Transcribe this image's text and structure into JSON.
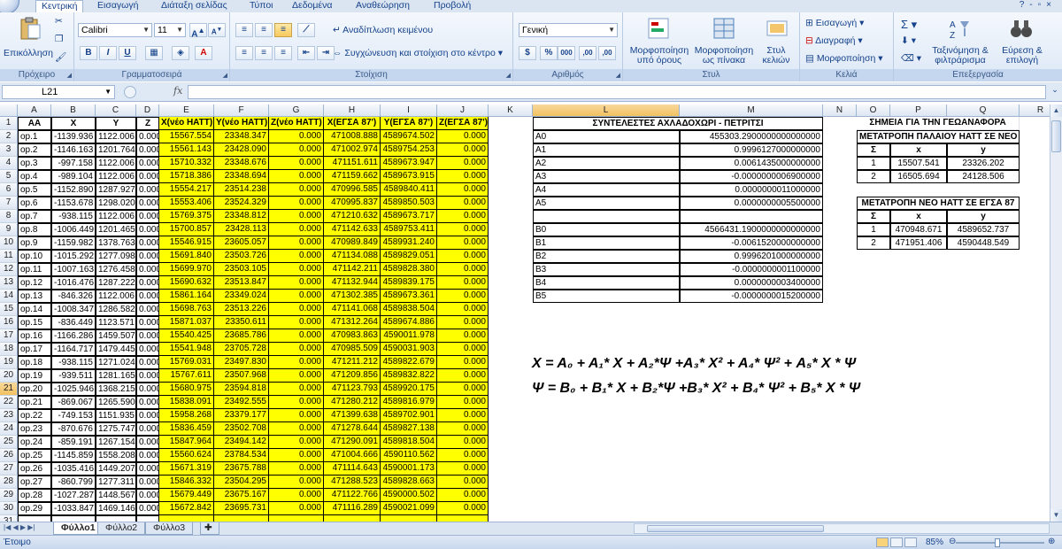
{
  "ribbon": {
    "tabs": [
      "Κεντρική",
      "Εισαγωγή",
      "Διάταξη σελίδας",
      "Τύποι",
      "Δεδομένα",
      "Αναθεώρηση",
      "Προβολή"
    ],
    "clipboard": {
      "label": "Πρόχειρο",
      "paste": "Επικόλληση"
    },
    "font": {
      "label": "Γραμματοσειρά",
      "name": "Calibri",
      "size": "11",
      "grow": "A",
      "shrink": "A",
      "bold": "B",
      "italic": "I",
      "underline": "U",
      "color": "A"
    },
    "alignment": {
      "label": "Στοίχιση",
      "wrap": "Αναδίπλωση κειμένου",
      "merge": "Συγχώνευση και στοίχιση στο κέντρο"
    },
    "number": {
      "label": "Αριθμός",
      "format": "Γενική",
      "percent": "%",
      "thousands": "000",
      "inc_dec": ",00",
      "dec_dec": ",00"
    },
    "styles": {
      "label": "Στυλ",
      "conditional": "Μορφοποίηση υπό όρους",
      "as_table": "Μορφοποίηση ως πίνακα",
      "cell_styles": "Στυλ κελιών"
    },
    "cells": {
      "label": "Κελιά",
      "insert": "Εισαγωγή",
      "delete": "Διαγραφή",
      "format": "Μορφοποίηση"
    },
    "editing": {
      "label": "Επεξεργασία",
      "sum": "Σ",
      "sort": "Ταξινόμηση & φιλτράρισμα",
      "find": "Εύρεση & επιλογή"
    }
  },
  "formula_bar": {
    "name_box": "L21",
    "fx": "fx",
    "content": ""
  },
  "columns": [
    "A",
    "B",
    "C",
    "D",
    "E",
    "F",
    "G",
    "H",
    "I",
    "J",
    "K",
    "L",
    "M",
    "N",
    "O",
    "P",
    "Q",
    "R",
    "S"
  ],
  "selected": {
    "row": "21",
    "col": "L"
  },
  "headers": [
    "AA",
    "X",
    "Y",
    "Z",
    "X(νέο HATT)",
    "Y(νέο HATT)",
    "Z(νέο HATT)",
    "X(ΕΓΣΑ 87')",
    "Y(ΕΓΣΑ 87')",
    "Z(ΕΓΣΑ 87')"
  ],
  "rows": [
    [
      "op.1",
      "-1139.936",
      "1122.006",
      "0.000",
      "15567.554",
      "23348.347",
      "0.000",
      "471008.888",
      "4589674.502",
      "0.000"
    ],
    [
      "op.2",
      "-1146.163",
      "1201.764",
      "0.000",
      "15561.143",
      "23428.090",
      "0.000",
      "471002.974",
      "4589754.253",
      "0.000"
    ],
    [
      "op.3",
      "-997.158",
      "1122.006",
      "0.000",
      "15710.332",
      "23348.676",
      "0.000",
      "471151.611",
      "4589673.947",
      "0.000"
    ],
    [
      "op.4",
      "-989.104",
      "1122.006",
      "0.000",
      "15718.386",
      "23348.694",
      "0.000",
      "471159.662",
      "4589673.915",
      "0.000"
    ],
    [
      "op.5",
      "-1152.890",
      "1287.927",
      "0.000",
      "15554.217",
      "23514.238",
      "0.000",
      "470996.585",
      "4589840.411",
      "0.000"
    ],
    [
      "op.6",
      "-1153.678",
      "1298.020",
      "0.000",
      "15553.406",
      "23524.329",
      "0.000",
      "470995.837",
      "4589850.503",
      "0.000"
    ],
    [
      "op.7",
      "-938.115",
      "1122.006",
      "0.000",
      "15769.375",
      "23348.812",
      "0.000",
      "471210.632",
      "4589673.717",
      "0.000"
    ],
    [
      "op.8",
      "-1006.449",
      "1201.465",
      "0.000",
      "15700.857",
      "23428.113",
      "0.000",
      "471142.633",
      "4589753.411",
      "0.000"
    ],
    [
      "op.9",
      "-1159.982",
      "1378.763",
      "0.000",
      "15546.915",
      "23605.057",
      "0.000",
      "470989.849",
      "4589931.240",
      "0.000"
    ],
    [
      "op.10",
      "-1015.292",
      "1277.098",
      "0.000",
      "15691.840",
      "23503.726",
      "0.000",
      "471134.088",
      "4589829.051",
      "0.000"
    ],
    [
      "op.11",
      "-1007.163",
      "1276.458",
      "0.000",
      "15699.970",
      "23503.105",
      "0.000",
      "471142.211",
      "4589828.380",
      "0.000"
    ],
    [
      "op.12",
      "-1016.476",
      "1287.222",
      "0.000",
      "15690.632",
      "23513.847",
      "0.000",
      "471132.944",
      "4589839.175",
      "0.000"
    ],
    [
      "op.13",
      "-846.326",
      "1122.006",
      "0.000",
      "15861.164",
      "23349.024",
      "0.000",
      "471302.385",
      "4589673.361",
      "0.000"
    ],
    [
      "op.14",
      "-1008.347",
      "1286.582",
      "0.000",
      "15698.763",
      "23513.226",
      "0.000",
      "471141.068",
      "4589838.504",
      "0.000"
    ],
    [
      "op.15",
      "-836.449",
      "1123.571",
      "0.000",
      "15871.037",
      "23350.611",
      "0.000",
      "471312.264",
      "4589674.886",
      "0.000"
    ],
    [
      "op.16",
      "-1166.286",
      "1459.507",
      "0.000",
      "15540.425",
      "23685.786",
      "0.000",
      "470983.863",
      "4590011.978",
      "0.000"
    ],
    [
      "op.17",
      "-1164.717",
      "1479.445",
      "0.000",
      "15541.948",
      "23705.728",
      "0.000",
      "470985.509",
      "4590031.903",
      "0.000"
    ],
    [
      "op.18",
      "-938.115",
      "1271.024",
      "0.000",
      "15769.031",
      "23497.830",
      "0.000",
      "471211.212",
      "4589822.679",
      "0.000"
    ],
    [
      "op.19",
      "-939.511",
      "1281.165",
      "0.000",
      "15767.611",
      "23507.968",
      "0.000",
      "471209.856",
      "4589832.822",
      "0.000"
    ],
    [
      "op.20",
      "-1025.946",
      "1368.215",
      "0.000",
      "15680.975",
      "23594.818",
      "0.000",
      "471123.793",
      "4589920.175",
      "0.000"
    ],
    [
      "op.21",
      "-869.067",
      "1265.590",
      "0.000",
      "15838.091",
      "23492.555",
      "0.000",
      "471280.212",
      "4589816.979",
      "0.000"
    ],
    [
      "op.22",
      "-749.153",
      "1151.935",
      "0.000",
      "15958.268",
      "23379.177",
      "0.000",
      "471399.638",
      "4589702.901",
      "0.000"
    ],
    [
      "op.23",
      "-870.676",
      "1275.747",
      "0.000",
      "15836.459",
      "23502.708",
      "0.000",
      "471278.644",
      "4589827.138",
      "0.000"
    ],
    [
      "op.24",
      "-859.191",
      "1267.154",
      "0.000",
      "15847.964",
      "23494.142",
      "0.000",
      "471290.091",
      "4589818.504",
      "0.000"
    ],
    [
      "op.25",
      "-1145.859",
      "1558.208",
      "0.000",
      "15560.624",
      "23784.534",
      "0.000",
      "471004.666",
      "4590110.562",
      "0.000"
    ],
    [
      "op.26",
      "-1035.416",
      "1449.207",
      "0.000",
      "15671.319",
      "23675.788",
      "0.000",
      "471114.643",
      "4590001.173",
      "0.000"
    ],
    [
      "op.27",
      "-860.799",
      "1277.311",
      "0.000",
      "15846.332",
      "23504.295",
      "0.000",
      "471288.523",
      "4589828.663",
      "0.000"
    ],
    [
      "op.28",
      "-1027.287",
      "1448.567",
      "0.000",
      "15679.449",
      "23675.167",
      "0.000",
      "471122.766",
      "4590000.502",
      "0.000"
    ],
    [
      "op.29",
      "-1033.847",
      "1469.146",
      "0.000",
      "15672.842",
      "23695.731",
      "0.000",
      "471116.289",
      "4590021.099",
      "0.000"
    ]
  ],
  "coef_table": {
    "title": "ΣΥΝΤΕΛΕΣΤΕΣ ΑΧΛΑΔΟΧΩΡΙ - ΠΕΤΡΙΤΣΙ",
    "rows": [
      [
        "A0",
        "455303.2900000000000000"
      ],
      [
        "A1",
        "0.9996127000000000"
      ],
      [
        "A2",
        "0.0061435000000000"
      ],
      [
        "A3",
        "-0.0000000006900000"
      ],
      [
        "A4",
        "0.0000000011000000"
      ],
      [
        "A5",
        "0.0000000005500000"
      ],
      [
        "",
        ""
      ],
      [
        "B0",
        "4566431.1900000000000000"
      ],
      [
        "B1",
        "-0.0061520000000000"
      ],
      [
        "B2",
        "0.9996201000000000"
      ],
      [
        "B3",
        "-0.0000000001100000"
      ],
      [
        "B4",
        "0.0000000003400000"
      ],
      [
        "B5",
        "-0.0000000015200000"
      ]
    ]
  },
  "ref_points": {
    "title": "ΣΗΜΕΙΑ ΓΙΑ ΤΗΝ ΓΕΩΑΝΑΦΟΡΑ",
    "old_to_new": {
      "title": "ΜΕΤΑΤΡΟΠΗ ΠΑΛΑΙΟΥ HATT ΣΕ ΝΕΟ HATT",
      "head": [
        "Σ",
        "x",
        "y"
      ],
      "rows": [
        [
          "1",
          "15507.541",
          "23326.202"
        ],
        [
          "2",
          "16505.694",
          "24128.506"
        ]
      ]
    },
    "new_to_egsa": {
      "title": "ΜΕΤΑΤΡΟΠΗ ΝΕΟ HATT ΣΕ ΕΓΣΑ 87",
      "head": [
        "Σ",
        "x",
        "y"
      ],
      "rows": [
        [
          "1",
          "470948.671",
          "4589652.737"
        ],
        [
          "2",
          "471951.406",
          "4590448.549"
        ]
      ]
    }
  },
  "equations": {
    "x": "X = A₀ + A₁* X + A₂*Ψ  +A₃* X²  + A₄* Ψ²  + A₅* X * Ψ",
    "psi": "Ψ = B₀ + B₁* X + B₂*Ψ  +B₃* X²  + B₄* Ψ²  + B₅* X * Ψ"
  },
  "sheets": [
    "Φύλλο1",
    "Φύλλο2",
    "Φύλλο3"
  ],
  "status": {
    "text": "Έτοιμο",
    "zoom": "85%"
  }
}
